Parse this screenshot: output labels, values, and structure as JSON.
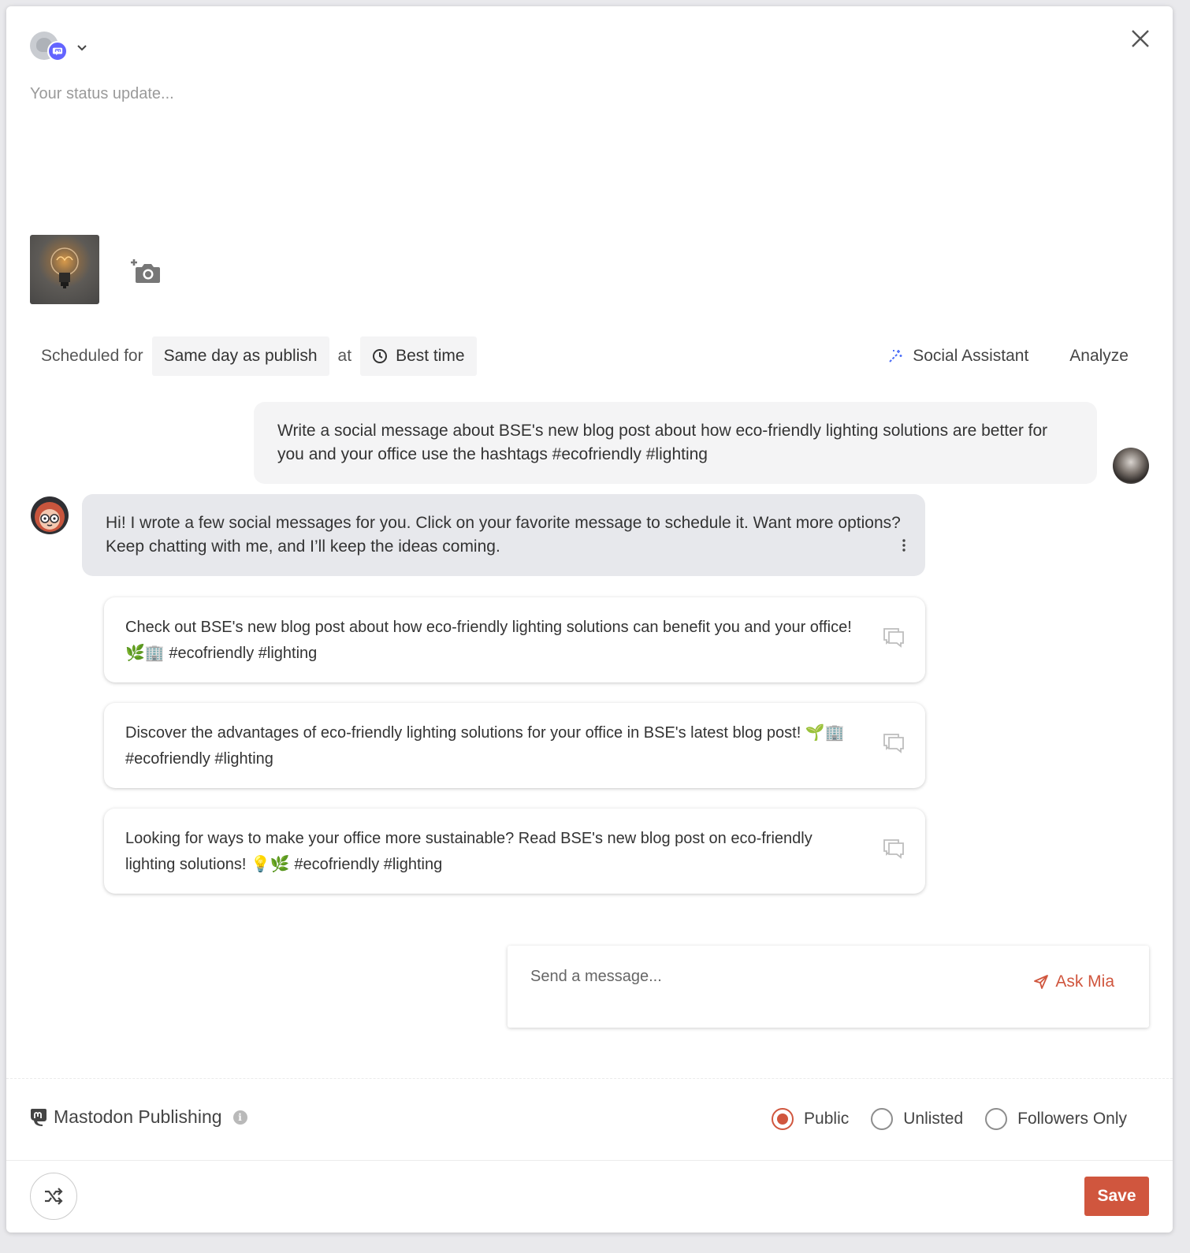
{
  "header": {
    "account_network": "mastodon",
    "close_label": "close"
  },
  "composer": {
    "placeholder": "Your status update..."
  },
  "schedule": {
    "label": "Scheduled for",
    "day_value": "Same day as publish",
    "at_label": "at",
    "time_value": "Best time"
  },
  "tools": {
    "assistant_label": "Social Assistant",
    "analyze_label": "Analyze"
  },
  "chat": {
    "user_message": "Write a social message about BSE's new blog post about how eco-friendly lighting solutions are better for you and your office use the hashtags #ecofriendly #lighting",
    "mia_message": "Hi! I wrote a few social messages for you. Click on your favorite message to schedule it. Want more options? Keep chatting with me, and I’ll keep the ideas coming.",
    "suggestions": [
      "Check out BSE's new blog post about how eco-friendly lighting solutions can benefit you and your office! 🌿🏢 #ecofriendly #lighting",
      "Discover the advantages of eco-friendly lighting solutions for your office in BSE's latest blog post! 🌱🏢 #ecofriendly #lighting",
      "Looking for ways to make your office more sustainable? Read BSE's new blog post on eco-friendly lighting solutions! 💡🌿 #ecofriendly #lighting"
    ]
  },
  "message_box": {
    "placeholder": "Send a message...",
    "send_label": "Ask Mia"
  },
  "publishing": {
    "title": "Mastodon Publishing",
    "visibility_options": [
      "Public",
      "Unlisted",
      "Followers Only"
    ],
    "selected": "Public"
  },
  "footer": {
    "save_label": "Save"
  },
  "colors": {
    "accent": "#d0563e",
    "mastodon": "#6364ff",
    "assistant_icon": "#4a6cf7"
  }
}
